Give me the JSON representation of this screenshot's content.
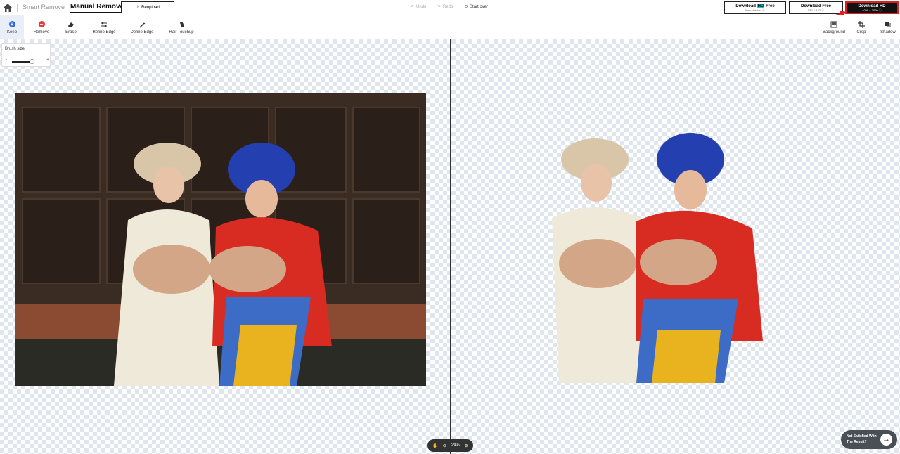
{
  "topbar": {
    "modes": {
      "smart": "Smart Remove",
      "manual": "Manual Remove"
    },
    "reupload_label": "Reupload",
    "history": {
      "undo": "Undo",
      "redo": "Redo",
      "start_over": "Start over"
    },
    "downloads": [
      {
        "title_pre": "Download ",
        "badge": "HD",
        "title_post": " Free",
        "sub": "New Version ⓘ"
      },
      {
        "title": "Download Free",
        "sub": "582 × 422 ⓘ"
      },
      {
        "title": "Download HD",
        "sub": "4000 × 3000 ⓘ"
      }
    ]
  },
  "toolbar": {
    "left": [
      "Keep",
      "Remove",
      "Erase",
      "Refine Edge",
      "Define Edge",
      "Hair Touchup"
    ],
    "right": [
      "Background",
      "Crop",
      "Shadow"
    ]
  },
  "brush": {
    "label": "Brush size",
    "minus": "-",
    "plus": "+",
    "level": 0.8
  },
  "zoom": {
    "value": "24%"
  },
  "feedback": {
    "line1": "Not Satisfied With",
    "line2": "The Result?"
  },
  "colors": {
    "accent_blue": "#2f6be0",
    "remove_red": "#e53935",
    "highlight_red": "#e02020",
    "hd_badge": "#14c9d6"
  }
}
